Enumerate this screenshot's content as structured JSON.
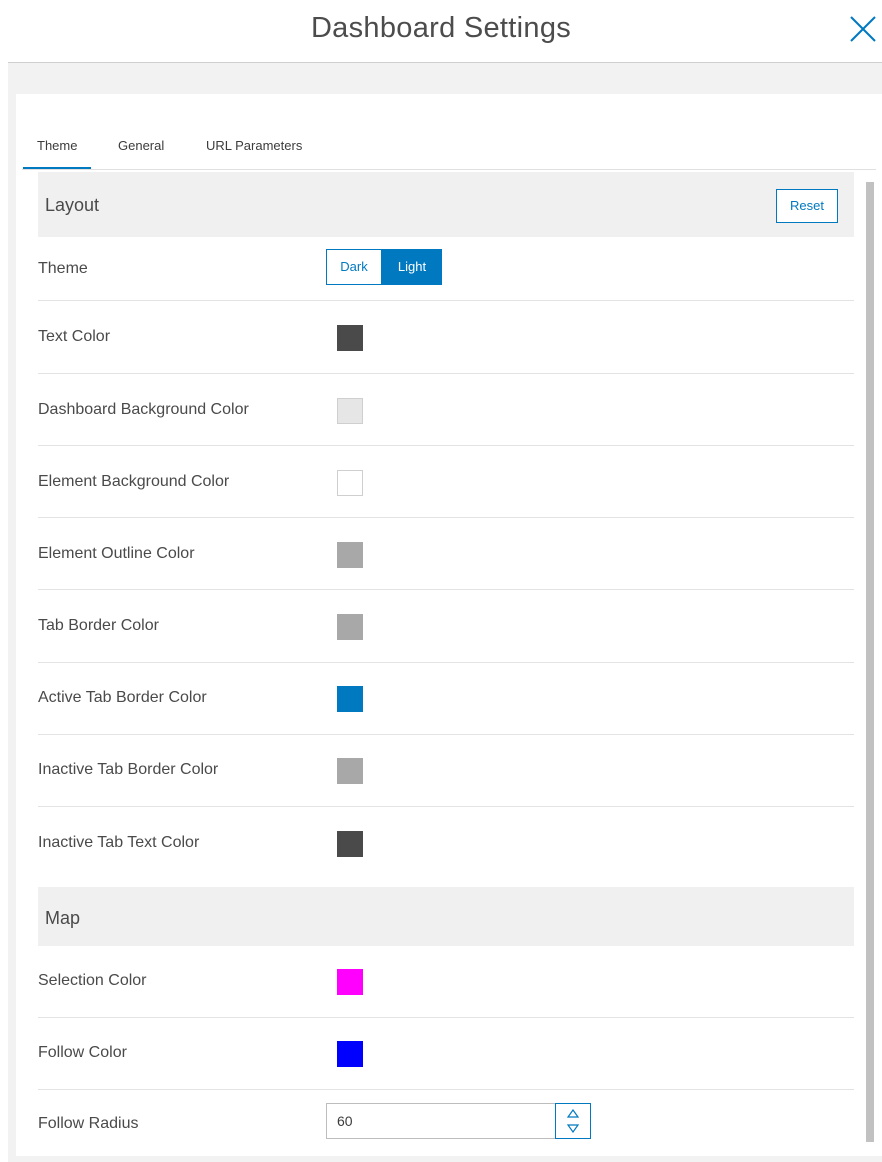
{
  "header": {
    "title": "Dashboard Settings",
    "close_icon": "close-icon"
  },
  "tabs": [
    {
      "label": "Theme",
      "active": true
    },
    {
      "label": "General",
      "active": false
    },
    {
      "label": "URL Parameters",
      "active": false
    }
  ],
  "layout_section": {
    "title": "Layout",
    "reset_label": "Reset",
    "theme_row": {
      "label": "Theme",
      "options": [
        "Dark",
        "Light"
      ],
      "selected": "Light"
    },
    "color_rows": [
      {
        "label": "Text Color",
        "color": "#4a4a4a"
      },
      {
        "label": "Dashboard Background Color",
        "color": "#e6e6e6"
      },
      {
        "label": "Element Background Color",
        "color": "#ffffff"
      },
      {
        "label": "Element Outline Color",
        "color": "#a8a8a8"
      },
      {
        "label": "Tab Border Color",
        "color": "#a8a8a8"
      },
      {
        "label": "Active Tab Border Color",
        "color": "#0079c1"
      },
      {
        "label": "Inactive Tab Border Color",
        "color": "#a8a8a8"
      },
      {
        "label": "Inactive Tab Text Color",
        "color": "#4a4a4a"
      }
    ]
  },
  "map_section": {
    "title": "Map",
    "color_rows": [
      {
        "label": "Selection Color",
        "color": "#ff00ff"
      },
      {
        "label": "Follow Color",
        "color": "#0000ff"
      }
    ],
    "radius_row": {
      "label": "Follow Radius",
      "value": "60"
    }
  },
  "colors": {
    "accent": "#0079c1"
  }
}
